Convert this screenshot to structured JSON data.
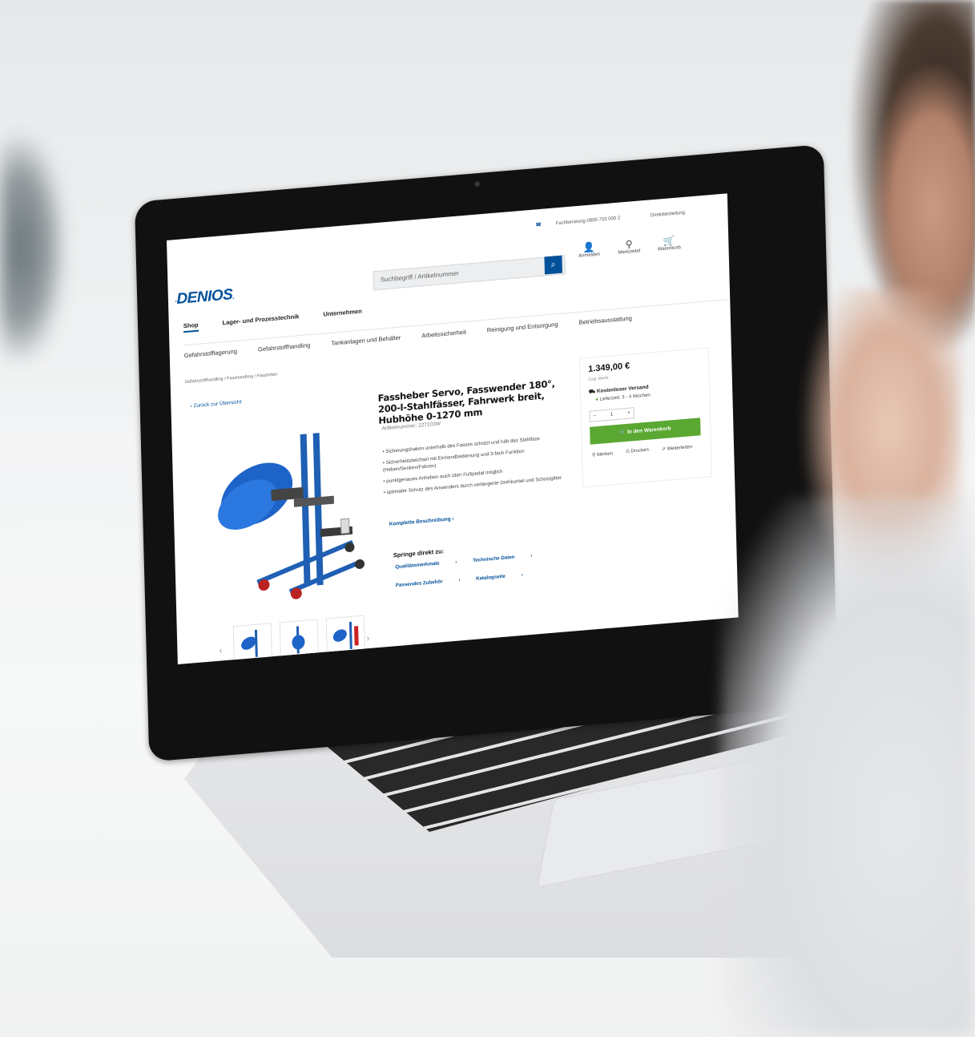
{
  "header": {
    "hotline": "Fachberatung 0800 753 000 2",
    "direct_order": "Direktbestellung",
    "logo": "DENIOS",
    "search_placeholder": "Suchbegriff / Artikelnummer",
    "account": "Anmelden",
    "wishlist": "Merkzettel",
    "cart": "Warenkorb"
  },
  "mainnav": [
    "Shop",
    "Lager- und Prozesstechnik",
    "Unternehmen"
  ],
  "subnav": [
    "Gefahrstofflagerung",
    "Gefahrstoffhandling",
    "Tankanlagen und Behälter",
    "Arbeitssicherheit",
    "Reinigung und Entsorgung",
    "Betriebsausstattung"
  ],
  "breadcrumb": "Gefahrstoffhandling / Fasshandling / Fassheber",
  "back_link": "Zurück zur Übersicht",
  "product": {
    "title": "Fassheber Servo, Fasswender 180°, 200-l-Stahlfässer, Fahrwerk breit, Hubhöhe 0-1270 mm",
    "article_number": "Artikelnummer: 227103W",
    "bullets": [
      "Sicherungshaken unterhalb des Fasses schützt und hält das Stahlfass",
      "Sicherheitsdeichsel mit Einhandbedienung und 3-fach Funktion (Heben/Senken/Fahren)",
      "punktgenaues Anheben auch über Fußpedal möglich",
      "optimaler Schutz des Anwenders durch verlängerte Drehkurbel und Schutzgitter"
    ],
    "full_description": "Komplette Beschreibung",
    "jump_title": "Springe direkt zu:",
    "jump_links": [
      "Qualitätsmerkmale",
      "Technische Daten",
      "Passendes Zubehör",
      "Katalogseite"
    ]
  },
  "buybox": {
    "price": "1.349,00 €",
    "price_note": "Zzgl. MwSt.",
    "shipping": "Kostenloser Versand",
    "delivery": "Lieferzeit: 3 - 4 Wochen",
    "quantity": "1",
    "add_to_cart": "In den Warenkorb",
    "remember": "Merken",
    "print": "Drucken",
    "share": "Weiterleiten"
  },
  "colors": {
    "brand_blue": "#00509a",
    "cart_green": "#5aa832"
  }
}
